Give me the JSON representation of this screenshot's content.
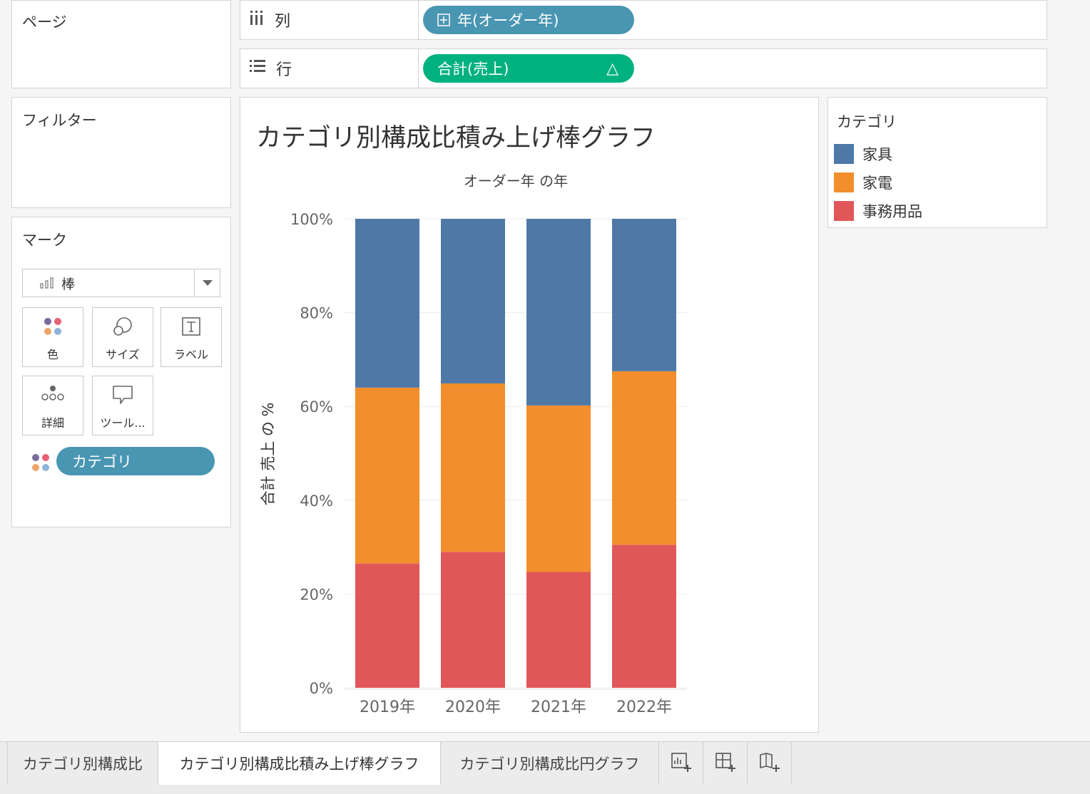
{
  "panels": {
    "pages_title": "ページ",
    "filters_title": "フィルター",
    "marks_title": "マーク"
  },
  "shelves": {
    "columns_label": "列",
    "columns_pill": "年(オーダー年)",
    "rows_label": "行",
    "rows_pill": "合計(売上)",
    "rows_pill_flag": "△"
  },
  "marks": {
    "type": "棒",
    "buttons": {
      "color": "色",
      "size": "サイズ",
      "label": "ラベル",
      "detail": "詳細",
      "tooltip": "ツール..."
    },
    "color_field": "カテゴリ"
  },
  "legend": {
    "title": "カテゴリ",
    "items": [
      {
        "label": "家具",
        "color": "#4e79a7"
      },
      {
        "label": "家電",
        "color": "#f28e2b"
      },
      {
        "label": "事務用品",
        "color": "#e15759"
      }
    ]
  },
  "view": {
    "title": "カテゴリ別構成比積み上げ棒グラフ"
  },
  "chart_data": {
    "type": "bar",
    "stacked": true,
    "top_header": "オーダー年 の年",
    "ylabel": "合計 売上 の %",
    "ylim": [
      0,
      100
    ],
    "yticks": [
      "0%",
      "20%",
      "40%",
      "60%",
      "80%",
      "100%"
    ],
    "categories": [
      "2019年",
      "2020年",
      "2021年",
      "2022年"
    ],
    "series": [
      {
        "name": "事務用品",
        "color": "#e15759",
        "values": [
          26.5,
          29.0,
          24.7,
          30.5
        ]
      },
      {
        "name": "家電",
        "color": "#f28e2b",
        "values": [
          37.5,
          35.9,
          35.5,
          37.0
        ]
      },
      {
        "name": "家具",
        "color": "#4e79a7",
        "values": [
          36.0,
          35.1,
          39.8,
          32.5
        ]
      }
    ]
  },
  "tabs": {
    "items": [
      {
        "label": "カテゴリ別構成比",
        "active": false
      },
      {
        "label": "カテゴリ別構成比積み上げ棒グラフ",
        "active": true
      },
      {
        "label": "カテゴリ別構成比円グラフ",
        "active": false
      }
    ]
  }
}
